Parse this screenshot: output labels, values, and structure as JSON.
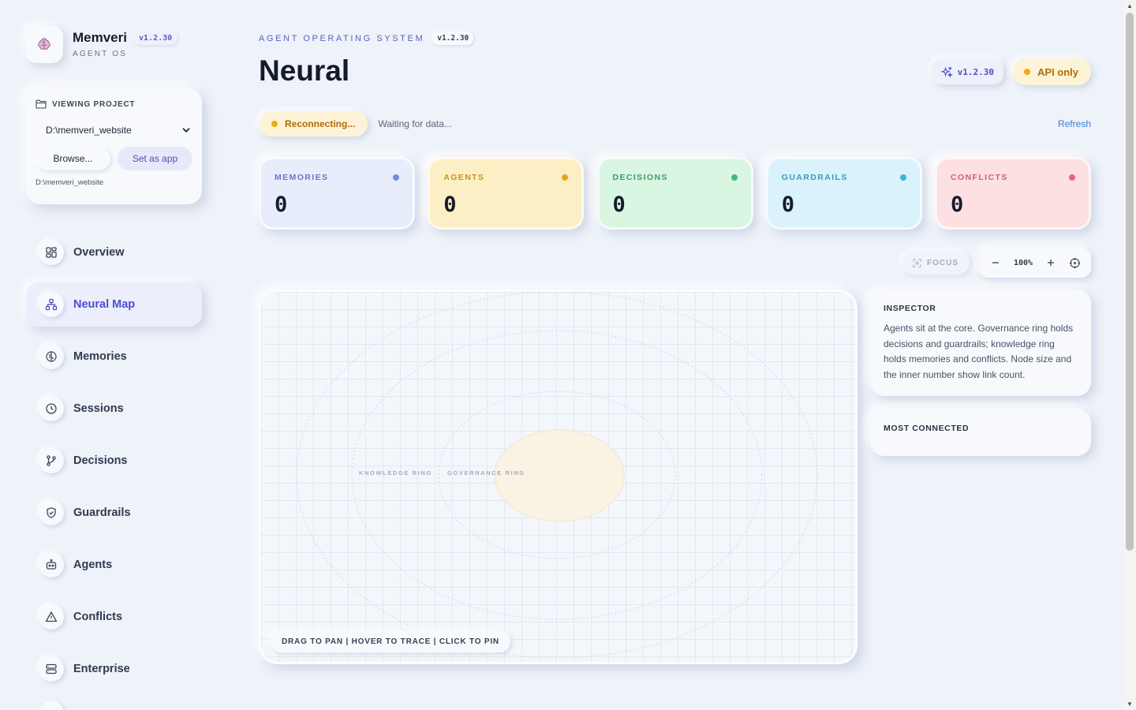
{
  "brand": {
    "name": "Memveri",
    "version": "v1.2.30",
    "subtitle": "AGENT OS",
    "logo_icon": "brain-icon"
  },
  "project": {
    "heading": "VIEWING PROJECT",
    "selected": "D:\\memveri_website",
    "browse_label": "Browse...",
    "set_app_label": "Set as app",
    "path": "D:\\memveri_website"
  },
  "nav": {
    "active": "Neural Map",
    "items": [
      {
        "label": "Overview",
        "icon": "grid-icon"
      },
      {
        "label": "Neural Map",
        "icon": "network-icon"
      },
      {
        "label": "Memories",
        "icon": "brain-icon"
      },
      {
        "label": "Sessions",
        "icon": "clock-icon"
      },
      {
        "label": "Decisions",
        "icon": "branch-icon"
      },
      {
        "label": "Guardrails",
        "icon": "shield-icon"
      },
      {
        "label": "Agents",
        "icon": "robot-icon"
      },
      {
        "label": "Conflicts",
        "icon": "warning-icon"
      },
      {
        "label": "Enterprise",
        "icon": "server-icon"
      }
    ]
  },
  "header": {
    "eyebrow": "AGENT OPERATING SYSTEM",
    "version": "v1.2.30",
    "title": "Neural",
    "version_chip": "v1.2.30",
    "api_label": "API only"
  },
  "status": {
    "state": "Reconnecting...",
    "message": "Waiting for data...",
    "refresh_label": "Refresh"
  },
  "stats": [
    {
      "label": "MEMORIES",
      "value": "0",
      "bg": "#e8edfb",
      "fg": "#6b75c4",
      "dot": "#7b8ae0"
    },
    {
      "label": "AGENTS",
      "value": "0",
      "bg": "#fdefc5",
      "fg": "#c7921f",
      "dot": "#e0a42a"
    },
    {
      "label": "DECISIONS",
      "value": "0",
      "bg": "#d8f6e2",
      "fg": "#3f9a62",
      "dot": "#48b874"
    },
    {
      "label": "GUARDRAILS",
      "value": "0",
      "bg": "#d9f2fb",
      "fg": "#3a9bbf",
      "dot": "#3fb2d6"
    },
    {
      "label": "CONFLICTS",
      "value": "0",
      "bg": "#fde0e2",
      "fg": "#d0616b",
      "dot": "#ea6672"
    }
  ],
  "map": {
    "focus_label": "FOCUS",
    "zoom": "100%",
    "ring_labels": {
      "knowledge": "KNOWLEDGE RING",
      "governance": "GOVERNANCE RING"
    },
    "hint": "DRAG TO PAN | HOVER TO TRACE | CLICK TO PIN"
  },
  "inspector": {
    "title": "INSPECTOR",
    "text": "Agents sit at the core. Governance ring holds decisions and guardrails; knowledge ring holds memories and conflicts. Node size and the inner number show link count."
  },
  "most_connected": {
    "title": "MOST CONNECTED"
  },
  "colors": {
    "accent": "#4a4fc9",
    "warning": "#f2a90f",
    "link": "#3b7bd3"
  }
}
